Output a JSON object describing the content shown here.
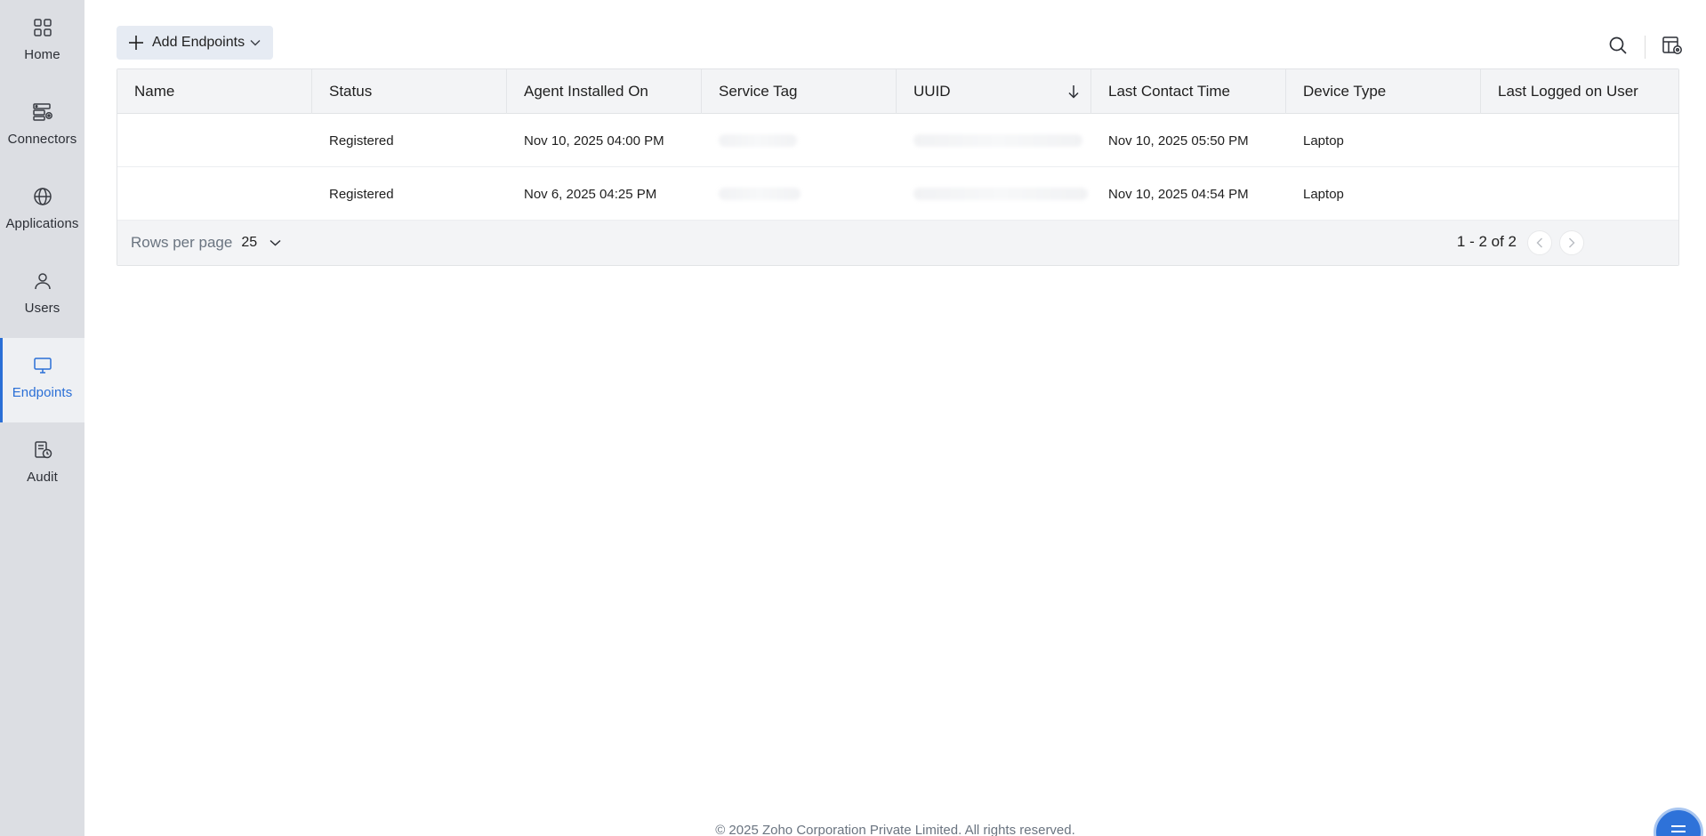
{
  "sidebar": {
    "items": [
      {
        "label": "Home",
        "icon": "grid-icon"
      },
      {
        "label": "Connectors",
        "icon": "server-gear-icon"
      },
      {
        "label": "Applications",
        "icon": "globe-icon"
      },
      {
        "label": "Users",
        "icon": "user-icon"
      },
      {
        "label": "Endpoints",
        "icon": "monitor-icon",
        "active": true
      },
      {
        "label": "Audit",
        "icon": "report-clock-icon"
      }
    ]
  },
  "toolbar": {
    "add_label": "Add Endpoints"
  },
  "table": {
    "columns": [
      "Name",
      "Status",
      "Agent Installed On",
      "Service Tag",
      "UUID",
      "Last Contact Time",
      "Device Type",
      "Last Logged on User"
    ],
    "sorted_column": "UUID",
    "sort_direction": "descending",
    "rows": [
      {
        "name": "",
        "status": "Registered",
        "installed": "Nov 10, 2025 04:00 PM",
        "service_tag": "",
        "uuid": "",
        "last_contact": "Nov 10, 2025 05:50 PM",
        "device_type": "Laptop",
        "last_user": ""
      },
      {
        "name": "",
        "status": "Registered",
        "installed": "Nov 6, 2025 04:25 PM",
        "service_tag": "",
        "uuid": "",
        "last_contact": "Nov 10, 2025 04:54 PM",
        "device_type": "Laptop",
        "last_user": ""
      }
    ]
  },
  "pagination": {
    "rows_per_page_label": "Rows per page",
    "rows_per_page": "25",
    "page_info": "1 - 2 of 2"
  },
  "footer": {
    "copyright": "© 2025 Zoho Corporation Private Limited. All rights reserved."
  },
  "colors": {
    "accent": "#2a6fd6",
    "sidebar_bg": "#dcdee3"
  }
}
